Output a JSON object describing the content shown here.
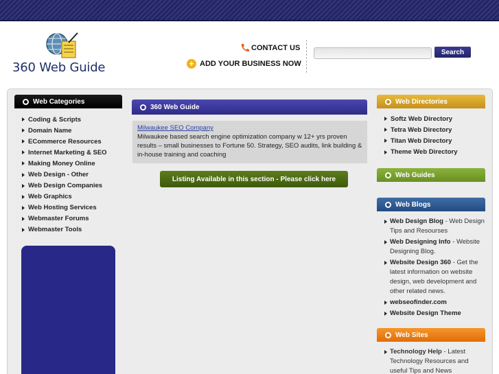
{
  "header": {
    "logo_text": "360 Web Guide",
    "contact_label": "CONTACT US",
    "add_business_label": "ADD YOUR BUSINESS NOW",
    "search_button_label": "Search",
    "search_value": ""
  },
  "left": {
    "heading": "Web Categories",
    "categories": [
      "Coding & Scripts",
      "Domain Name",
      "ECommerce Resources",
      "Internet Marketing & SEO",
      "Making Money Online",
      "Web Design - Other",
      "Web Design Companies",
      "Web Graphics",
      "Web Hosting Services",
      "Webmaster Forums",
      "Webmaster Tools"
    ]
  },
  "center": {
    "heading": "360 Web Guide",
    "listing_title": "Milwaukee SEO Company",
    "listing_desc": "Milwaukee based search engine optimization company w 12+ yrs proven results – small businesses to Fortune 50. Strategy, SEO audits, link building & in-house training and coaching",
    "listing_button_label": "Listing Available in this section - Please click here"
  },
  "right": {
    "directories_heading": "Web Directories",
    "directories": [
      "Softz Web Directory",
      "Tetra Web Directory",
      "Titan Web Directory",
      "Theme Web Directory"
    ],
    "guides_heading": "Web Guides",
    "blogs_heading": "Web Blogs",
    "blogs": [
      {
        "name": "Web Design Blog",
        "desc": " - Web Design Tips and Resourses"
      },
      {
        "name": "Web Designing Info",
        "desc": " - Website Designing Blog."
      },
      {
        "name": "Website Design 360",
        "desc": " - Get the latest information on website design, web development and other related news."
      },
      {
        "name": "webseofinder.com",
        "desc": ""
      },
      {
        "name": "Website Design Theme",
        "desc": ""
      }
    ],
    "sites_heading": "Web Sites",
    "sites": [
      {
        "name": "Technology Help",
        "desc": " - Latest Technology Resources and useful Tips and News"
      }
    ]
  },
  "colors": {
    "top_band": "#2a2c6e",
    "center_heading": "#3b38a0",
    "listing_button": "#4e6c14",
    "directories": "#d9a52b",
    "guides": "#7aa02f",
    "blogs": "#2f5c96",
    "sites": "#f0841a",
    "left_panel": "#272888"
  },
  "icons": [
    "globe-logo-icon",
    "phone-icon",
    "plus-circle-icon",
    "bullet-dot-icon",
    "triangle-bullet-icon"
  ]
}
